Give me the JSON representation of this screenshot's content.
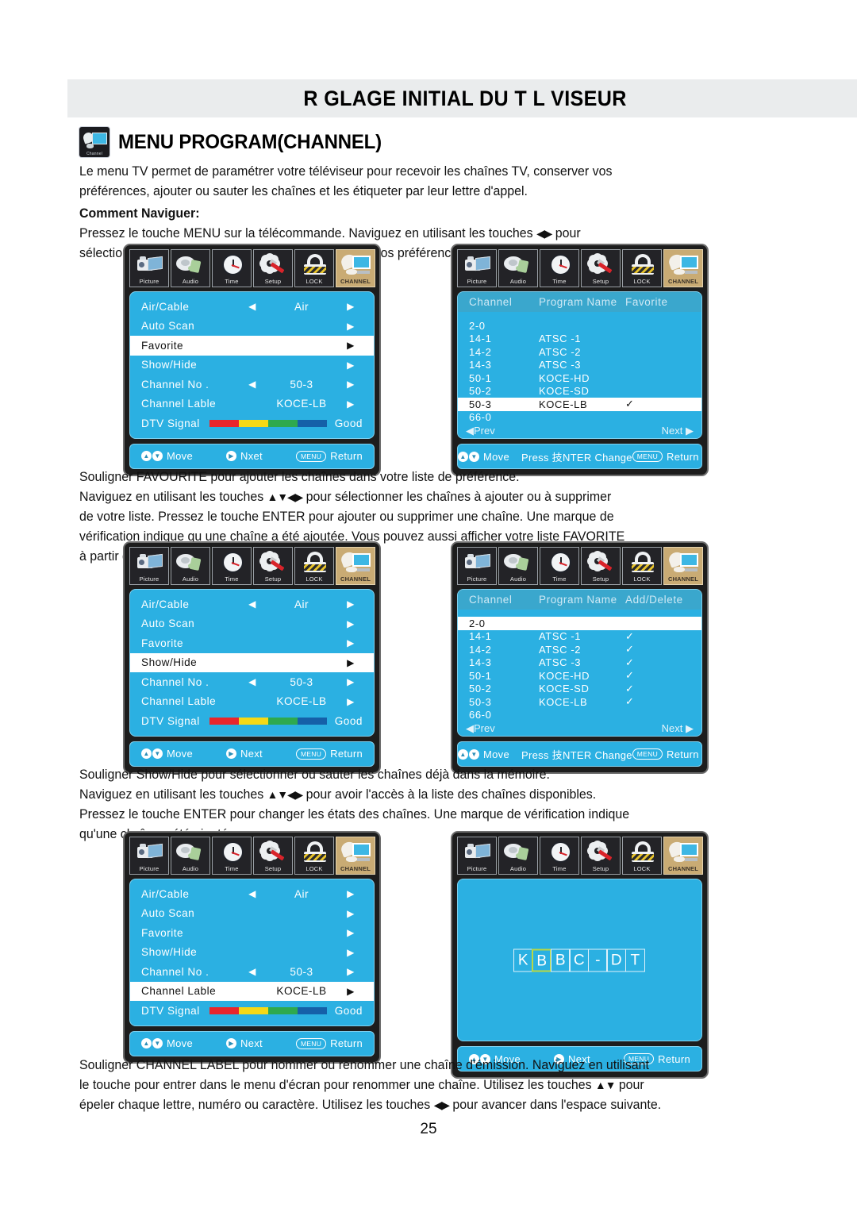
{
  "header": {
    "title": "R GLAGE INITIAL DU T L VISEUR"
  },
  "section": {
    "icon_label": "Channel",
    "title": "MENU PROGRAM(CHANNEL)"
  },
  "intro": {
    "line1": "Le menu TV permet de paramétrer votre téléviseur pour recevoir les chaînes TV, conserver vos",
    "line2": "préférences, ajouter ou sauter les chaînes et les étiqueter par leur lettre d'appel.",
    "subheading": "Comment Naviguer:",
    "line3a": "Pressez le touche MENU sur la télécommande. Naviguez en utilisant les touches ",
    "line3_glyph": "◀▶",
    "line3b": " pour",
    "line4a": "sélectionner TV. Pressez le touche ",
    "line4_glyph": "▼",
    "line4b": " pour souligner vos préférences."
  },
  "note_favourite": {
    "line1": "Souligner FAVOURITE pour ajouter les chaînes dans votre liste de préférence.",
    "line2a": "Naviguez en utilisant les touches ",
    "line2_glyph": "▲▼◀▶",
    "line2b": " pour sélectionner les chaînes à ajouter ou à supprimer",
    "line3": "de votre liste. Pressez le touche ENTER pour ajouter ou supprimer une chaîne. Une marque de",
    "line4": "vérification indique qu une chaîne a été ajoutée. Vous pouvez aussi afficher votre liste FAVORITE",
    "line5": "à partir de la télécommande en pressant FAV."
  },
  "note_showhide": {
    "line1": "Souligner Show/Hide pour sélectionner ou sauter les chaînes déjà dans la mémoire.",
    "line2a": "Naviguez en utilisant les touches ",
    "line2_glyph": "▲▼◀▶",
    "line2b": " pour avoir l'accès à la liste des chaînes disponibles.",
    "line3": "Pressez le touche ENTER pour changer les états des chaînes. Une marque de vérification indique",
    "line4": "qu'une chaîne a été ajoutée."
  },
  "note_label": {
    "line1": "Souligner CHANNEL LABEL pour nommer ou renommer une chaîne d'émission. Naviguez en utilisant",
    "line2a": "le touche pour entrer dans le menu d'écran pour renommer une chaîne. Utilisez les touches ",
    "line2_glyph": "▲▼",
    "line2b": " pour",
    "line3a": "épeler chaque lettre, numéro ou caractère. Utilisez les touches ",
    "line3_glyph": "◀▶",
    "line3b": " pour avancer dans l'espace suivante."
  },
  "icon_bar": [
    {
      "name": "picture-icon",
      "label": "Picture",
      "active": false
    },
    {
      "name": "audio-icon",
      "label": "Audio",
      "active": false
    },
    {
      "name": "time-icon",
      "label": "Time",
      "active": false
    },
    {
      "name": "setup-icon",
      "label": "Setup",
      "active": false
    },
    {
      "name": "lock-icon",
      "label": "LOCK",
      "active": false
    },
    {
      "name": "channel-icon",
      "label": "CHANNEL",
      "active": true
    }
  ],
  "signal_colors": [
    "#e8262c",
    "#f5d916",
    "#2eа94e",
    "#1560a8"
  ],
  "signal_colors_fixed": [
    "#e8262c",
    "#f5d916",
    "#2ea94e",
    "#1560a8"
  ],
  "menu_panel_1": {
    "rows": [
      {
        "name": "Air/Cable",
        "left": "◀",
        "value": "Air",
        "right": "▶",
        "selected": false
      },
      {
        "name": "Auto Scan",
        "left": "",
        "value": "",
        "right": "▶",
        "selected": false
      },
      {
        "name": "Favorite",
        "left": "",
        "value": "",
        "right": "▶",
        "selected": true
      },
      {
        "name": "Show/Hide",
        "left": "",
        "value": "",
        "right": "▶",
        "selected": false
      },
      {
        "name": "Channel No .",
        "left": "◀",
        "value": "50-3",
        "right": "▶",
        "selected": false
      },
      {
        "name": "Channel Lable",
        "left": "",
        "value": "KOCE-LB",
        "right": "▶",
        "selected": false
      }
    ],
    "signal": {
      "label": "DTV Signal",
      "quality": "Good"
    },
    "footer": {
      "move": "Move",
      "next": "Nxet",
      "menu_key": "MENU",
      "return": "Return"
    }
  },
  "menu_panel_3": {
    "rows": [
      {
        "name": "Air/Cable",
        "left": "◀",
        "value": "Air",
        "right": "▶",
        "selected": false
      },
      {
        "name": "Auto Scan",
        "left": "",
        "value": "",
        "right": "▶",
        "selected": false
      },
      {
        "name": "Favorite",
        "left": "",
        "value": "",
        "right": "▶",
        "selected": false
      },
      {
        "name": "Show/Hide",
        "left": "",
        "value": "",
        "right": "▶",
        "selected": true
      },
      {
        "name": "Channel No .",
        "left": "◀",
        "value": "50-3",
        "right": "▶",
        "selected": false
      },
      {
        "name": "Channel Lable",
        "left": "",
        "value": "KOCE-LB",
        "right": "▶",
        "selected": false
      }
    ],
    "signal": {
      "label": "DTV Signal",
      "quality": "Good"
    },
    "footer": {
      "move": "Move",
      "next": "Next",
      "menu_key": "MENU",
      "return": "Return"
    }
  },
  "menu_panel_5": {
    "rows": [
      {
        "name": "Air/Cable",
        "left": "◀",
        "value": "Air",
        "right": "▶",
        "selected": false
      },
      {
        "name": "Auto Scan",
        "left": "",
        "value": "",
        "right": "▶",
        "selected": false
      },
      {
        "name": "Favorite",
        "left": "",
        "value": "",
        "right": "▶",
        "selected": false
      },
      {
        "name": "Show/Hide",
        "left": "",
        "value": "",
        "right": "▶",
        "selected": false
      },
      {
        "name": "Channel No .",
        "left": "◀",
        "value": "50-3",
        "right": "▶",
        "selected": false
      },
      {
        "name": "Channel Lable",
        "left": "",
        "value": "KOCE-LB",
        "right": "▶",
        "selected": true
      }
    ],
    "signal": {
      "label": "DTV Signal",
      "quality": "Good"
    },
    "footer": {
      "move": "Move",
      "next": "Next",
      "menu_key": "MENU",
      "return": "Return"
    }
  },
  "list_panel_favorite": {
    "columns": [
      "Channel",
      "Program Name",
      "Favorite"
    ],
    "rows": [
      {
        "channel": "2-0",
        "program": "",
        "mark": "",
        "selected": false
      },
      {
        "channel": "14-1",
        "program": "ATSC -1",
        "mark": "",
        "selected": false
      },
      {
        "channel": "14-2",
        "program": "ATSC -2",
        "mark": "",
        "selected": false
      },
      {
        "channel": "14-3",
        "program": "ATSC -3",
        "mark": "",
        "selected": false
      },
      {
        "channel": "50-1",
        "program": "KOCE-HD",
        "mark": "",
        "selected": false
      },
      {
        "channel": "50-2",
        "program": "KOCE-SD",
        "mark": "",
        "selected": false
      },
      {
        "channel": "50-3",
        "program": "KOCE-LB",
        "mark": "✓",
        "selected": true
      },
      {
        "channel": "66-0",
        "program": "",
        "mark": "",
        "selected": false
      }
    ],
    "prev": "Prev",
    "next": "Next",
    "footer": {
      "move": "Move",
      "change": "Press 技NTER Change",
      "menu_key": "MENU",
      "return": "Return"
    }
  },
  "list_panel_adddelete": {
    "columns": [
      "Channel",
      "Program Name",
      "Add/Delete"
    ],
    "rows": [
      {
        "channel": "2-0",
        "program": "",
        "mark": "",
        "selected": true
      },
      {
        "channel": "14-1",
        "program": "ATSC -1",
        "mark": "✓",
        "selected": false
      },
      {
        "channel": "14-2",
        "program": "ATSC -2",
        "mark": "✓",
        "selected": false
      },
      {
        "channel": "14-3",
        "program": "ATSC -3",
        "mark": "✓",
        "selected": false
      },
      {
        "channel": "50-1",
        "program": "KOCE-HD",
        "mark": "✓",
        "selected": false
      },
      {
        "channel": "50-2",
        "program": "KOCE-SD",
        "mark": "✓",
        "selected": false
      },
      {
        "channel": "50-3",
        "program": "KOCE-LB",
        "mark": "✓",
        "selected": false
      },
      {
        "channel": "66-0",
        "program": "",
        "mark": "",
        "selected": false
      }
    ],
    "prev": "Prev",
    "next": "Next",
    "footer": {
      "move": "Move",
      "change": "Press 技NTER Change",
      "menu_key": "MENU",
      "return": "Return"
    }
  },
  "label_editor": {
    "boxes": [
      {
        "char": "K",
        "current": false
      },
      {
        "char": "B",
        "current": true
      },
      {
        "char": "B",
        "current": false
      },
      {
        "char": "C",
        "current": false
      },
      {
        "char": "-",
        "current": false
      },
      {
        "char": "D",
        "current": false
      },
      {
        "char": "T",
        "current": false
      }
    ],
    "footer": {
      "move": "Move",
      "next": "Next",
      "menu_key": "MENU",
      "return": "Return"
    }
  },
  "page_number": "25"
}
